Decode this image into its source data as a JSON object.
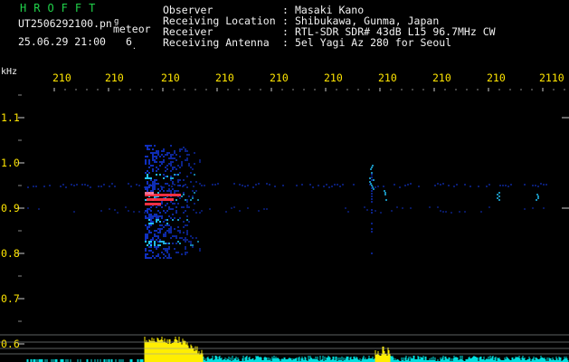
{
  "header": {
    "brand": "HROFFT",
    "filename": "UT2506292100.pn",
    "filename_suffix": "g",
    "mode": "meteor",
    "datetime": "25.06.29 21:00",
    "count": "6"
  },
  "station": {
    "observer_label": "Observer",
    "observer_value": "Masaki Kano",
    "location_label": "Receiving Location",
    "location_value": "Shibukawa, Gunma, Japan",
    "receiver_label": "Receiver",
    "receiver_value": "RTL-SDR SDR# 43dB L15 96.7MHz CW",
    "antenna_label": "Receiving Antenna",
    "antenna_value": "5el Yagi Az 280 for Seoul"
  },
  "axis": {
    "unit": "kHz",
    "time_ticks": [
      "210",
      "210",
      "210",
      "210",
      "210",
      "210",
      "210",
      "210",
      "210",
      "2110"
    ],
    "freq_ticks": [
      "1.1",
      "1.0",
      "0.9",
      "0.8",
      "0.7",
      "0.6"
    ]
  },
  "colors": {
    "background": "#000000",
    "text": "#f2f2f2",
    "brand": "#20d24a",
    "tick": "#ffe600",
    "signal_core": "#ff3344",
    "signal_mid": "#22c8ff",
    "signal_low": "#1030c0",
    "spectrum_burst": "#ffee00",
    "spectrum_noise": "#00e0e0"
  }
}
